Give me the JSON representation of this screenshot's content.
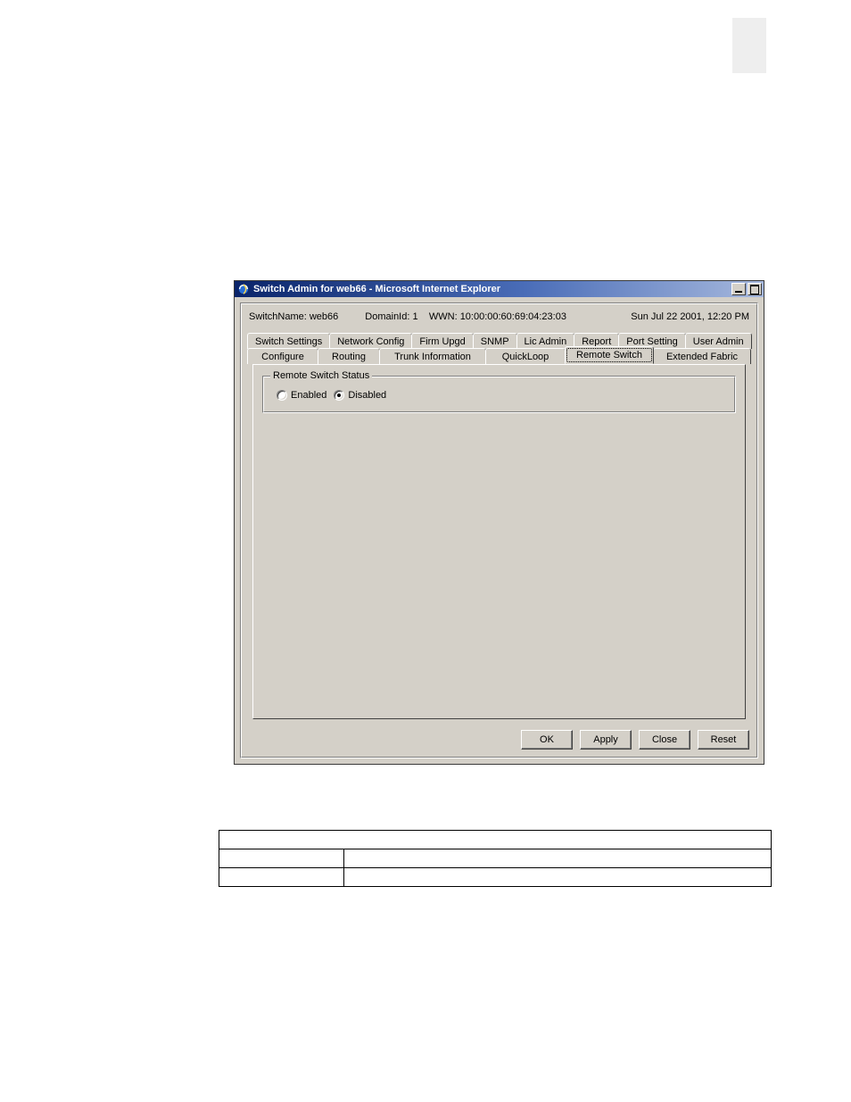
{
  "window": {
    "title": "Switch Admin for web66 - Microsoft Internet Explorer"
  },
  "header": {
    "switchNameLabel": "SwitchName:",
    "switchName": "web66",
    "domainLabel": "DomainId:",
    "domainId": "1",
    "wwnLabel": "WWN:",
    "wwn": "10:00:00:60:69:04:23:03",
    "timestamp": "Sun Jul 22  2001, 12:20 PM"
  },
  "tabs": {
    "row1": [
      "Switch Settings",
      "Network Config",
      "Firm Upgd",
      "SNMP",
      "Lic Admin",
      "Report",
      "Port Setting",
      "User Admin"
    ],
    "row2": [
      "Configure",
      "Routing",
      "Trunk Information",
      "QuickLoop",
      "Remote Switch",
      "Extended Fabric"
    ],
    "active": "Remote Switch"
  },
  "group": {
    "legend": "Remote Switch Status",
    "options": {
      "enabled": "Enabled",
      "disabled": "Disabled"
    },
    "selected": "disabled"
  },
  "buttons": {
    "ok": "OK",
    "apply": "Apply",
    "close": "Close",
    "reset": "Reset"
  },
  "table": {
    "head": "",
    "rows": [
      {
        "c1": "",
        "c2": ""
      },
      {
        "c1": "",
        "c2": ""
      }
    ]
  }
}
